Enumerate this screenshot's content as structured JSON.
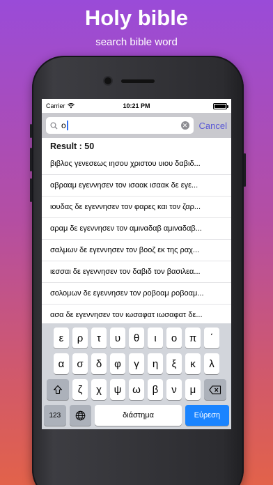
{
  "promo": {
    "title": "Holy bible",
    "subtitle": "search bible word"
  },
  "status": {
    "carrier": "Carrier",
    "time": "10:21 PM"
  },
  "search": {
    "value": "ο",
    "cancel_label": "Cancel"
  },
  "result_label": "Result : 50",
  "results": [
    "βιβλος γενεσεως ιησου χριστου υιου δαβιδ...",
    "αβρααμ εγεννησεν τον ισαακ ισαακ δε εγε...",
    "ιουδας δε εγεννησεν τον φαρες και τον ζαρ...",
    "αραμ δε εγεννησεν τον αμιναδαβ αμιναδαβ...",
    "σαλμων δε εγεννησεν τον βοοζ εκ της ραχ...",
    "ιεσσαι δε εγεννησεν τον δαβιδ τον βασιλεα...",
    "σολομων δε εγεννησεν τον ροβοαμ ροβοαμ...",
    "ασα δε εγεννησεν τον ιωσαφατ ιωσαφατ δε..."
  ],
  "keyboard": {
    "row1": [
      "ε",
      "ρ",
      "τ",
      "υ",
      "θ",
      "ι",
      "ο",
      "π",
      "΄"
    ],
    "row2": [
      "α",
      "σ",
      "δ",
      "φ",
      "γ",
      "η",
      "ξ",
      "κ",
      "λ"
    ],
    "row3": [
      "ζ",
      "χ",
      "ψ",
      "ω",
      "β",
      "ν",
      "μ"
    ],
    "numbers_label": "123",
    "space_label": "διάστημα",
    "search_label": "Εύρεση"
  },
  "colors": {
    "accent": "#5856d6",
    "search_key": "#1a84ff"
  }
}
